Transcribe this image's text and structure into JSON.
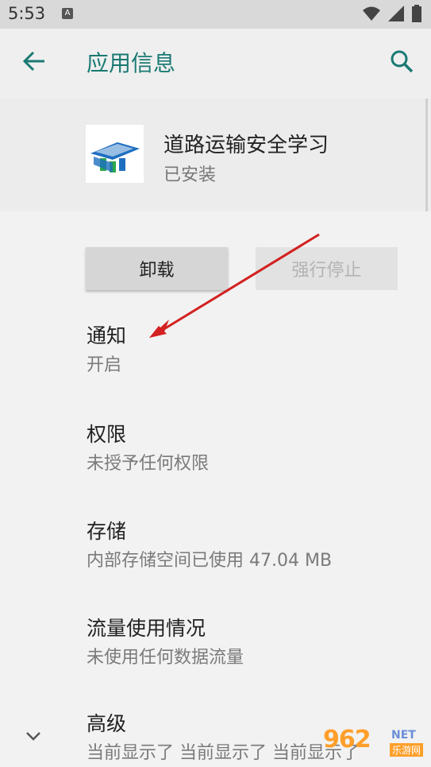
{
  "status_bar": {
    "time": "5:53",
    "notif_badge": "A"
  },
  "app_bar": {
    "title": "应用信息"
  },
  "app": {
    "name": "道路运输安全学习",
    "status": "已安装"
  },
  "buttons": {
    "uninstall": "卸载",
    "force_stop": "强行停止"
  },
  "settings": [
    {
      "title": "通知",
      "subtitle": "开启"
    },
    {
      "title": "权限",
      "subtitle": "未授予任何权限"
    },
    {
      "title": "存储",
      "subtitle": "内部存储空间已使用 47.04 MB"
    },
    {
      "title": "流量使用情况",
      "subtitle": "未使用任何数据流量"
    },
    {
      "title": "高级",
      "subtitle": "当前显示了 当前显示了 当前显示了"
    }
  ],
  "watermark": {
    "logo": "962",
    "net": "NET",
    "sub": "乐游网"
  },
  "colors": {
    "accent": "#1a7a73",
    "arrow": "#d32020"
  }
}
